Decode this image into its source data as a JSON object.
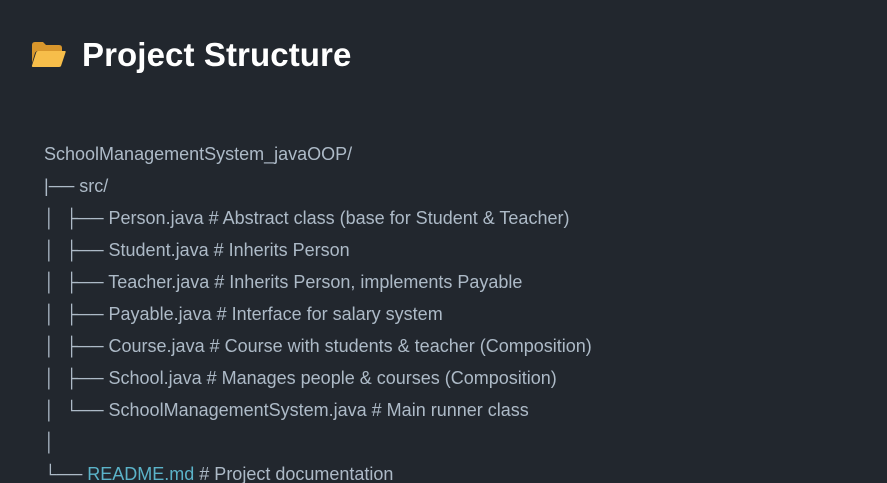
{
  "header": {
    "icon": "open-folder-icon",
    "title": "Project Structure"
  },
  "tree": {
    "lines": [
      {
        "prefix": "",
        "name": "SchoolManagementSystem_javaOOP/",
        "comment": ""
      },
      {
        "prefix": "|── ",
        "name": "src/",
        "comment": ""
      },
      {
        "prefix": "│  ├── ",
        "name": "Person.java",
        "comment": " # Abstract class (base for Student & Teacher)"
      },
      {
        "prefix": "│  ├── ",
        "name": "Student.java",
        "comment": " # Inherits Person"
      },
      {
        "prefix": "│  ├── ",
        "name": "Teacher.java",
        "comment": " # Inherits Person, implements Payable"
      },
      {
        "prefix": "│  ├── ",
        "name": "Payable.java",
        "comment": " # Interface for salary system"
      },
      {
        "prefix": "│  ├── ",
        "name": "Course.java",
        "comment": " # Course with students & teacher (Composition)"
      },
      {
        "prefix": "│  ├── ",
        "name": "School.java",
        "comment": " # Manages people & courses (Composition)"
      },
      {
        "prefix": "│  └── ",
        "name": "SchoolManagementSystem.java",
        "comment": " # Main runner class"
      },
      {
        "prefix": "│",
        "name": "",
        "comment": ""
      },
      {
        "prefix": "└── ",
        "name": "README.md",
        "comment": " # Project documentation"
      }
    ]
  },
  "colors": {
    "background": "#22272e",
    "text": "#adbac7",
    "title": "#ffffff",
    "link": "#5bb3c9",
    "folder": "#f5b942"
  }
}
